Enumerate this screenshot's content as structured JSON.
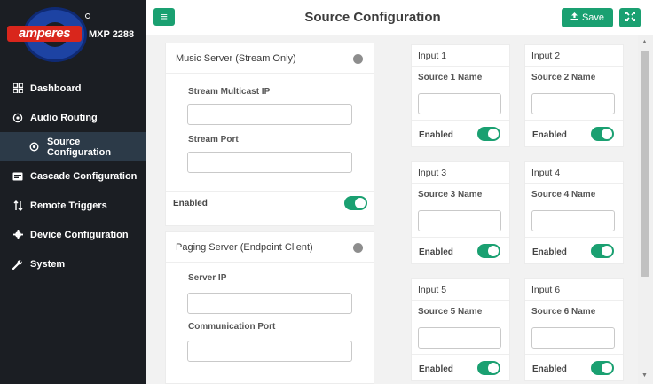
{
  "brand": {
    "name": "amperes",
    "model": "MXP 2288"
  },
  "sidebar": {
    "items": [
      {
        "label": "Dashboard",
        "icon": "grid-icon"
      },
      {
        "label": "Audio Routing",
        "icon": "routing-icon"
      },
      {
        "label": "Source Configuration",
        "icon": "target-icon"
      },
      {
        "label": "Cascade Configuration",
        "icon": "card-icon"
      },
      {
        "label": "Remote Triggers",
        "icon": "sort-arrows-icon"
      },
      {
        "label": "Device Configuration",
        "icon": "gear-icon"
      },
      {
        "label": "System",
        "icon": "wrench-icon"
      }
    ]
  },
  "header": {
    "title": "Source Configuration",
    "save_label": "Save"
  },
  "music_server": {
    "title": "Music Server (Stream Only)",
    "ip_label": "Stream Multicast IP",
    "ip_value": "",
    "port_label": "Stream Port",
    "port_value": "",
    "enabled_label": "Enabled"
  },
  "paging_server": {
    "title": "Paging Server (Endpoint Client)",
    "ip_label": "Server IP",
    "ip_value": "",
    "port_label": "Communication Port",
    "port_value": ""
  },
  "inputs": [
    {
      "title": "Input 1",
      "name_label": "Source 1 Name",
      "value": "",
      "enabled_label": "Enabled"
    },
    {
      "title": "Input 2",
      "name_label": "Source 2 Name",
      "value": "",
      "enabled_label": "Enabled"
    },
    {
      "title": "Input 3",
      "name_label": "Source 3 Name",
      "value": "",
      "enabled_label": "Enabled"
    },
    {
      "title": "Input 4",
      "name_label": "Source 4 Name",
      "value": "",
      "enabled_label": "Enabled"
    },
    {
      "title": "Input 5",
      "name_label": "Source 5 Name",
      "value": "",
      "enabled_label": "Enabled"
    },
    {
      "title": "Input 6",
      "name_label": "Source 6 Name",
      "value": "",
      "enabled_label": "Enabled"
    }
  ],
  "colors": {
    "accent": "#1aa071",
    "sidebar": "#1b1e23",
    "active": "#2c3a48",
    "brand_red": "#d9261c",
    "brand_blue": "#1d43a3"
  }
}
